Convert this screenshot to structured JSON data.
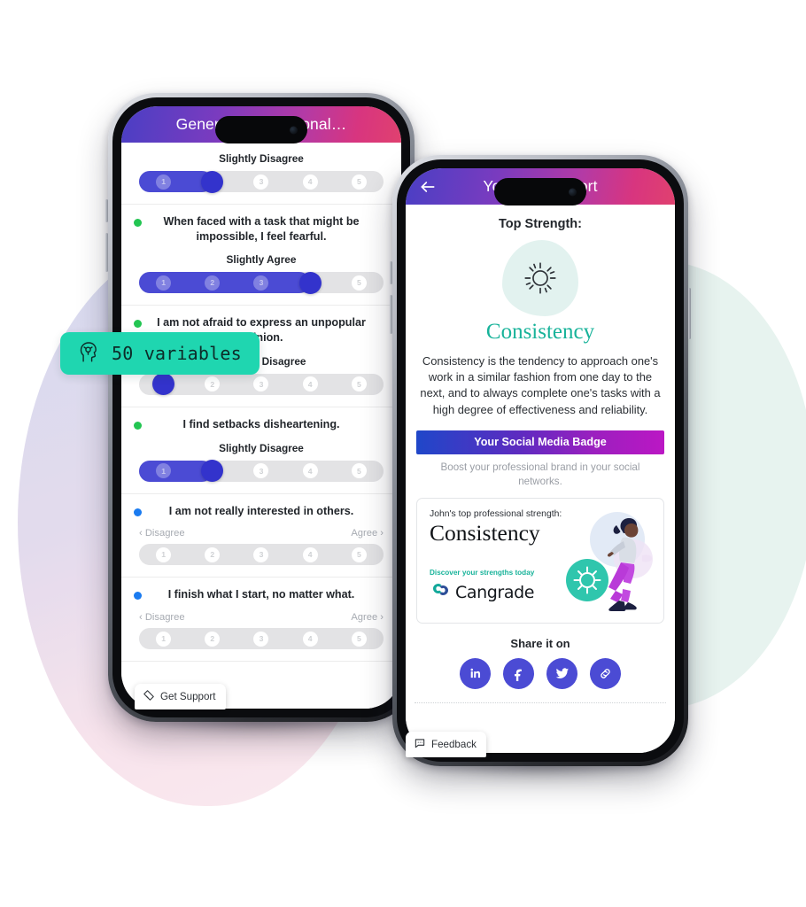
{
  "pill": {
    "label": "50 variables",
    "icon": "head-brain-icon",
    "color": "#1fd6b0"
  },
  "survey_phone": {
    "header": {
      "title": "General M… Personal…",
      "gradient_from": "#4a3fc4",
      "gradient_to": "#e0416f"
    },
    "widget": {
      "label": "Get Support",
      "icon": "ticket-icon"
    },
    "scale_min_label": "Disagree",
    "scale_max_label": "Agree",
    "questions": [
      {
        "text": "",
        "dot": "",
        "answer": "Slightly Disagree",
        "value": 2,
        "filled": true,
        "ticks": [
          "1",
          "2",
          "3",
          "4",
          "5"
        ],
        "show_endlabels": false,
        "partial_top": true
      },
      {
        "text": "When faced with a task that might be impossible, I feel fearful.",
        "dot": "green",
        "answer": "Slightly Agree",
        "value": 4,
        "filled": true,
        "ticks": [
          "1",
          "2",
          "3",
          "4",
          "5"
        ],
        "show_endlabels": false
      },
      {
        "text": "I am not afraid to express an unpopular opinion.",
        "dot": "green",
        "answer": "Strongly Disagree",
        "value": 1,
        "filled": false,
        "ticks": [
          "1",
          "2",
          "3",
          "4",
          "5"
        ],
        "show_endlabels": false
      },
      {
        "text": "I find setbacks disheartening.",
        "dot": "green",
        "answer": "Slightly Disagree",
        "value": 2,
        "filled": true,
        "ticks": [
          "1",
          "2",
          "3",
          "4",
          "5"
        ],
        "show_endlabels": false
      },
      {
        "text": "I am not really interested in others.",
        "dot": "blue",
        "answer": "",
        "value": 0,
        "filled": false,
        "ticks": [
          "1",
          "2",
          "3",
          "4",
          "5"
        ],
        "show_endlabels": true
      },
      {
        "text": "I finish what I start, no matter what.",
        "dot": "blue",
        "answer": "",
        "value": 0,
        "filled": false,
        "ticks": [
          "1",
          "2",
          "3",
          "4",
          "5"
        ],
        "show_endlabels": true
      }
    ]
  },
  "report_phone": {
    "header": {
      "title": "Your C… Report",
      "back_icon": "back-arrow-icon"
    },
    "top_strength_label": "Top Strength:",
    "strength_icon": "sun-icon",
    "strength_name": "Consistency",
    "strength_name_color": "#18b39a",
    "strength_description": "Consistency is the tendency to approach one's work in a similar fashion from one day to the next, and to always complete one's tasks with a high degree of effectiveness and reliability.",
    "badge_bar_label": "Your Social Media Badge",
    "badge_subtitle": "Boost your professional brand in your social networks.",
    "badge_card": {
      "kicker": "John's top professional strength:",
      "title": "Consistency",
      "discover": "Discover your strengths today",
      "brand": "Cangrade",
      "illustration": "walking-person-illustration",
      "sun_icon": "sun-icon"
    },
    "share_title": "Share it on",
    "share_buttons": [
      {
        "name": "linkedin",
        "glyph": "in"
      },
      {
        "name": "facebook",
        "glyph": "f"
      },
      {
        "name": "twitter",
        "glyph": "bird"
      },
      {
        "name": "copy-link",
        "glyph": "link"
      }
    ],
    "widget": {
      "label": "Feedback",
      "icon": "speech-bubble-icon"
    }
  }
}
